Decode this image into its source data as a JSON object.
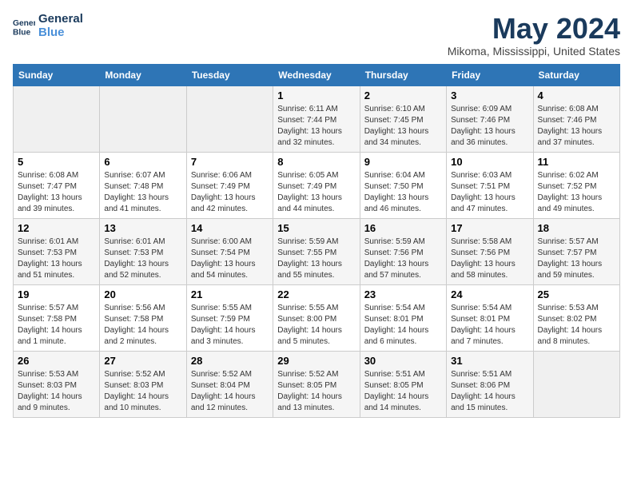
{
  "header": {
    "logo_line1": "General",
    "logo_line2": "Blue",
    "month": "May 2024",
    "location": "Mikoma, Mississippi, United States"
  },
  "weekdays": [
    "Sunday",
    "Monday",
    "Tuesday",
    "Wednesday",
    "Thursday",
    "Friday",
    "Saturday"
  ],
  "weeks": [
    [
      {
        "day": "",
        "info": ""
      },
      {
        "day": "",
        "info": ""
      },
      {
        "day": "",
        "info": ""
      },
      {
        "day": "1",
        "info": "Sunrise: 6:11 AM\nSunset: 7:44 PM\nDaylight: 13 hours and 32 minutes."
      },
      {
        "day": "2",
        "info": "Sunrise: 6:10 AM\nSunset: 7:45 PM\nDaylight: 13 hours and 34 minutes."
      },
      {
        "day": "3",
        "info": "Sunrise: 6:09 AM\nSunset: 7:46 PM\nDaylight: 13 hours and 36 minutes."
      },
      {
        "day": "4",
        "info": "Sunrise: 6:08 AM\nSunset: 7:46 PM\nDaylight: 13 hours and 37 minutes."
      }
    ],
    [
      {
        "day": "5",
        "info": "Sunrise: 6:08 AM\nSunset: 7:47 PM\nDaylight: 13 hours and 39 minutes."
      },
      {
        "day": "6",
        "info": "Sunrise: 6:07 AM\nSunset: 7:48 PM\nDaylight: 13 hours and 41 minutes."
      },
      {
        "day": "7",
        "info": "Sunrise: 6:06 AM\nSunset: 7:49 PM\nDaylight: 13 hours and 42 minutes."
      },
      {
        "day": "8",
        "info": "Sunrise: 6:05 AM\nSunset: 7:49 PM\nDaylight: 13 hours and 44 minutes."
      },
      {
        "day": "9",
        "info": "Sunrise: 6:04 AM\nSunset: 7:50 PM\nDaylight: 13 hours and 46 minutes."
      },
      {
        "day": "10",
        "info": "Sunrise: 6:03 AM\nSunset: 7:51 PM\nDaylight: 13 hours and 47 minutes."
      },
      {
        "day": "11",
        "info": "Sunrise: 6:02 AM\nSunset: 7:52 PM\nDaylight: 13 hours and 49 minutes."
      }
    ],
    [
      {
        "day": "12",
        "info": "Sunrise: 6:01 AM\nSunset: 7:53 PM\nDaylight: 13 hours and 51 minutes."
      },
      {
        "day": "13",
        "info": "Sunrise: 6:01 AM\nSunset: 7:53 PM\nDaylight: 13 hours and 52 minutes."
      },
      {
        "day": "14",
        "info": "Sunrise: 6:00 AM\nSunset: 7:54 PM\nDaylight: 13 hours and 54 minutes."
      },
      {
        "day": "15",
        "info": "Sunrise: 5:59 AM\nSunset: 7:55 PM\nDaylight: 13 hours and 55 minutes."
      },
      {
        "day": "16",
        "info": "Sunrise: 5:59 AM\nSunset: 7:56 PM\nDaylight: 13 hours and 57 minutes."
      },
      {
        "day": "17",
        "info": "Sunrise: 5:58 AM\nSunset: 7:56 PM\nDaylight: 13 hours and 58 minutes."
      },
      {
        "day": "18",
        "info": "Sunrise: 5:57 AM\nSunset: 7:57 PM\nDaylight: 13 hours and 59 minutes."
      }
    ],
    [
      {
        "day": "19",
        "info": "Sunrise: 5:57 AM\nSunset: 7:58 PM\nDaylight: 14 hours and 1 minute."
      },
      {
        "day": "20",
        "info": "Sunrise: 5:56 AM\nSunset: 7:58 PM\nDaylight: 14 hours and 2 minutes."
      },
      {
        "day": "21",
        "info": "Sunrise: 5:55 AM\nSunset: 7:59 PM\nDaylight: 14 hours and 3 minutes."
      },
      {
        "day": "22",
        "info": "Sunrise: 5:55 AM\nSunset: 8:00 PM\nDaylight: 14 hours and 5 minutes."
      },
      {
        "day": "23",
        "info": "Sunrise: 5:54 AM\nSunset: 8:01 PM\nDaylight: 14 hours and 6 minutes."
      },
      {
        "day": "24",
        "info": "Sunrise: 5:54 AM\nSunset: 8:01 PM\nDaylight: 14 hours and 7 minutes."
      },
      {
        "day": "25",
        "info": "Sunrise: 5:53 AM\nSunset: 8:02 PM\nDaylight: 14 hours and 8 minutes."
      }
    ],
    [
      {
        "day": "26",
        "info": "Sunrise: 5:53 AM\nSunset: 8:03 PM\nDaylight: 14 hours and 9 minutes."
      },
      {
        "day": "27",
        "info": "Sunrise: 5:52 AM\nSunset: 8:03 PM\nDaylight: 14 hours and 10 minutes."
      },
      {
        "day": "28",
        "info": "Sunrise: 5:52 AM\nSunset: 8:04 PM\nDaylight: 14 hours and 12 minutes."
      },
      {
        "day": "29",
        "info": "Sunrise: 5:52 AM\nSunset: 8:05 PM\nDaylight: 14 hours and 13 minutes."
      },
      {
        "day": "30",
        "info": "Sunrise: 5:51 AM\nSunset: 8:05 PM\nDaylight: 14 hours and 14 minutes."
      },
      {
        "day": "31",
        "info": "Sunrise: 5:51 AM\nSunset: 8:06 PM\nDaylight: 14 hours and 15 minutes."
      },
      {
        "day": "",
        "info": ""
      }
    ]
  ]
}
